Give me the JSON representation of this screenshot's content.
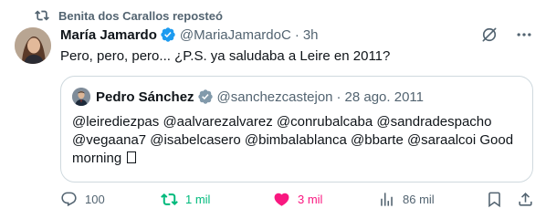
{
  "repost_banner": {
    "text": "Benita dos Carallos reposteó",
    "icon": "repost-icon"
  },
  "tweet": {
    "author_name": "María Jamardo",
    "handle": "@MariaJamardoC",
    "separator": "·",
    "time": "3h",
    "text": "Pero, pero, pero... ¿P.S. ya saludaba a Leire en 2011?",
    "verified_color": "#1d9bf0"
  },
  "quote": {
    "author_name": "Pedro Sánchez",
    "handle": "@sanchezcastejon",
    "separator": "·",
    "time": "28 ago. 2011",
    "verified_color": "#829aab",
    "line1": "@leirediezpas @aalvarezalvarez @conrubalcaba @sandradespacho",
    "line2": "@vegaana7 @isabelcasero @bimbalablanca @bbarte @saraalcoi Good",
    "line3": "morning"
  },
  "actions": {
    "replies": "100",
    "reposts": "1 mil",
    "likes": "3 mil",
    "views": "86 mil",
    "repost_color": "#00ba7c",
    "like_color": "#f91880"
  },
  "icons": {
    "grok": "grok-icon",
    "more": "more-icon",
    "reply": "reply-icon",
    "repost": "repost-icon",
    "like": "heart-icon",
    "views": "views-icon",
    "bookmark": "bookmark-icon",
    "share": "share-icon"
  }
}
